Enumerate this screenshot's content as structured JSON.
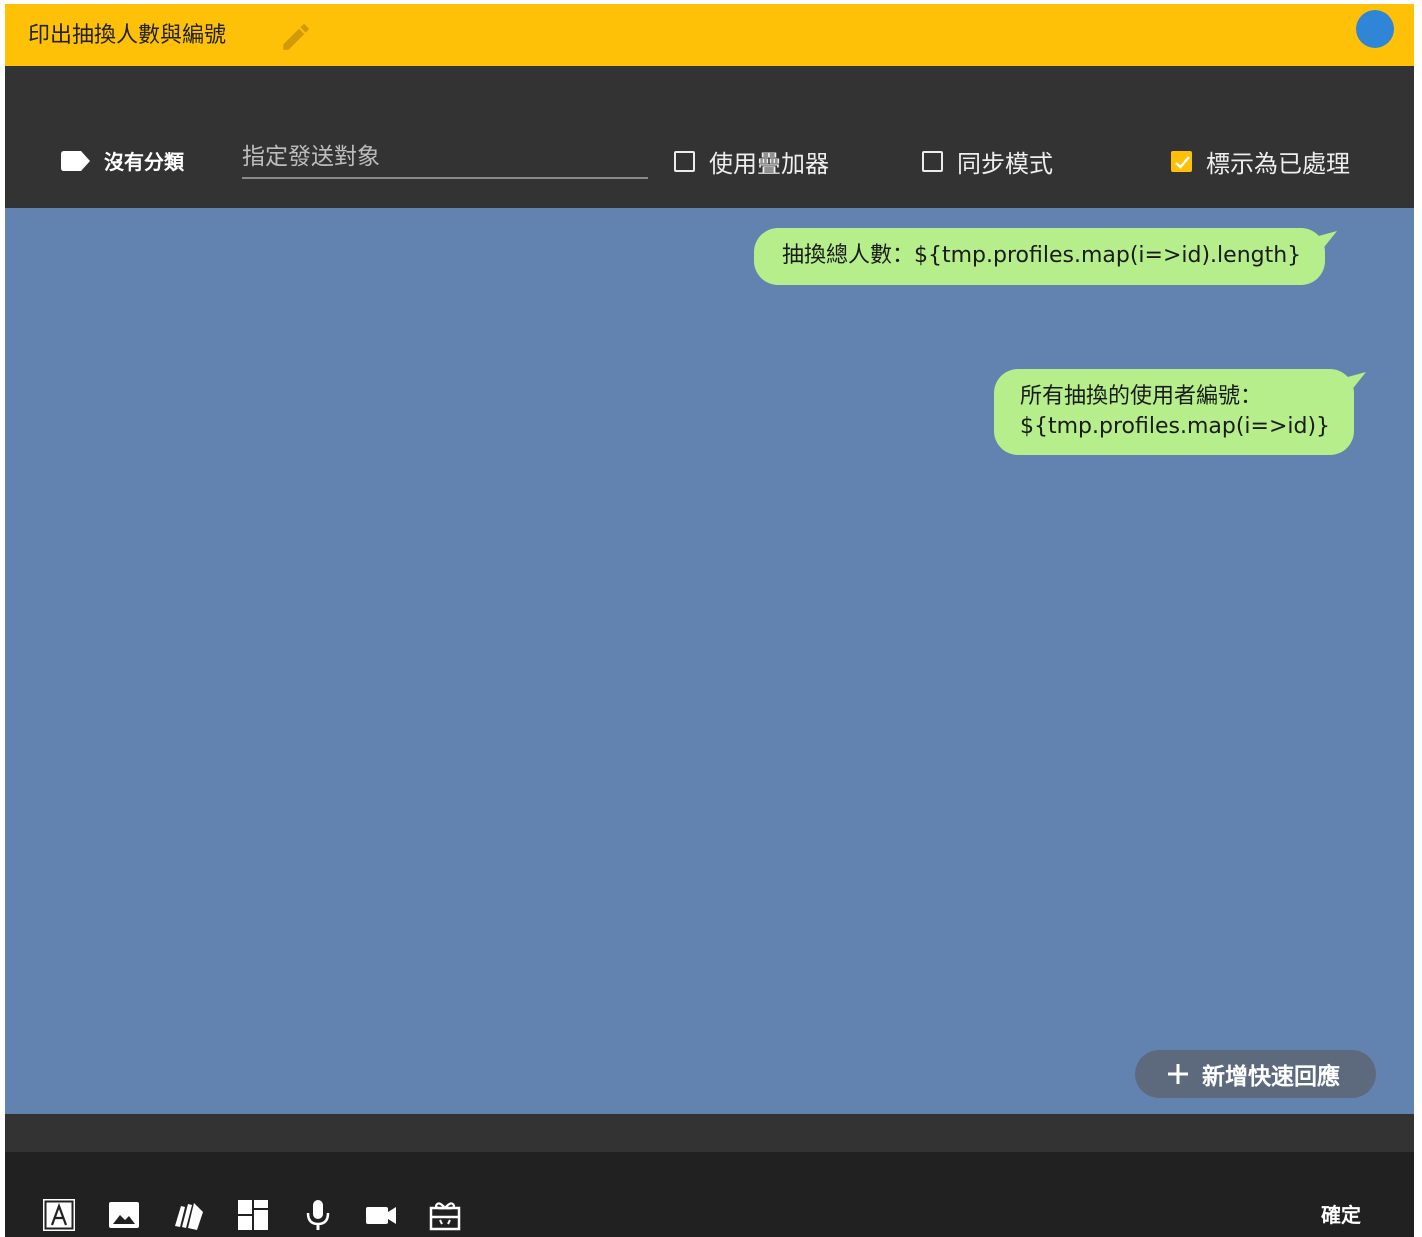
{
  "header": {
    "title": "印出抽換人數與編號",
    "edit_icon": "pencil-icon",
    "status_color": "#2f86d6",
    "background_color": "#ffc107"
  },
  "toolbar": {
    "category_label": "沒有分類",
    "category_icon": "label-icon",
    "target_placeholder": "指定發送對象",
    "target_value": "",
    "options": [
      {
        "label": "使用疊加器",
        "checked": false
      },
      {
        "label": "同步模式",
        "checked": false
      },
      {
        "label": "標示為已處理",
        "checked": true
      }
    ]
  },
  "messages": [
    {
      "text": "抽換總人數：${tmp.profiles.map(i=>id).length}"
    },
    {
      "lines": [
        "所有抽換的使用者編號：",
        "${tmp.profiles.map(i=>id)}"
      ]
    }
  ],
  "add_quick_reply_label": "新增快速回應",
  "bottom": {
    "tools": [
      "text-icon",
      "image-icon",
      "cards-icon",
      "layout-icon",
      "microphone-icon",
      "video-icon",
      "gift-icon"
    ],
    "confirm_label": "確定"
  },
  "colors": {
    "canvas": "#6283b0",
    "bubble": "#b5ee8b",
    "toolbar": "#333333",
    "accent": "#ffc107"
  }
}
